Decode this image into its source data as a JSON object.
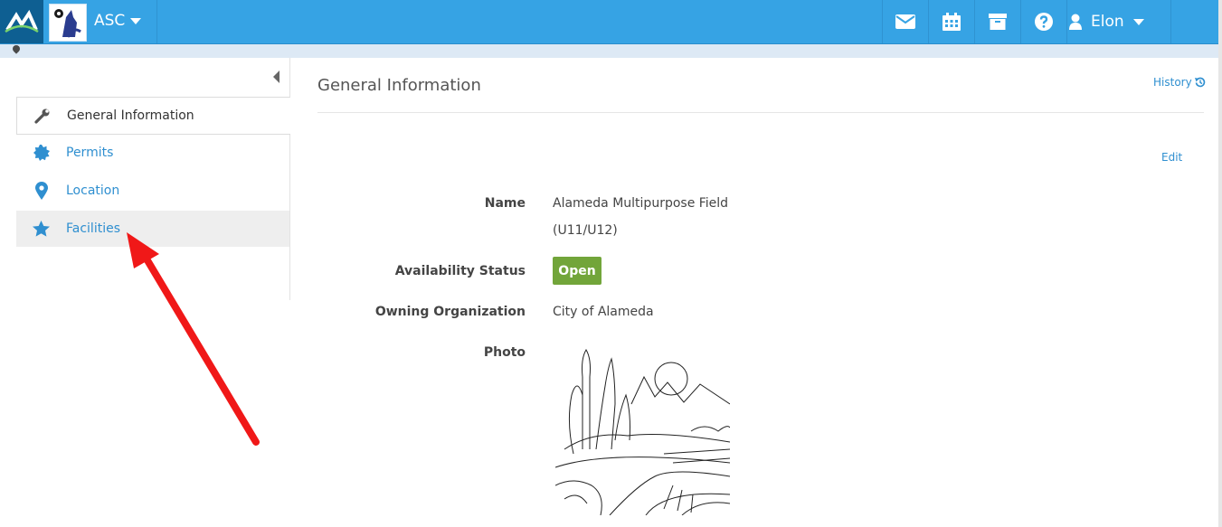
{
  "header": {
    "org_name": "ASC",
    "user_name": "Elon",
    "icons": [
      "mail-icon",
      "calendar-icon",
      "archive-icon",
      "help-icon",
      "user-icon"
    ]
  },
  "sidebar": {
    "items": [
      {
        "label": "General Information",
        "icon": "wrench-icon"
      },
      {
        "label": "Permits",
        "icon": "badge-icon"
      },
      {
        "label": "Location",
        "icon": "map-pin-icon"
      },
      {
        "label": "Facilities",
        "icon": "star-icon"
      }
    ]
  },
  "content": {
    "title": "General Information",
    "history_label": "History",
    "edit_label": "Edit",
    "fields": {
      "name_label": "Name",
      "name_value_line1": "Alameda Multipurpose Field",
      "name_value_line2": "(U11/U12)",
      "status_label": "Availability Status",
      "status_value": "Open",
      "org_label": "Owning Organization",
      "org_value": "City of Alameda",
      "photo_label": "Photo"
    }
  },
  "colors": {
    "header_bg": "#36a3e4",
    "link": "#2f8fd0",
    "status_open": "#72a53a",
    "annotation_arrow": "#f01818"
  }
}
